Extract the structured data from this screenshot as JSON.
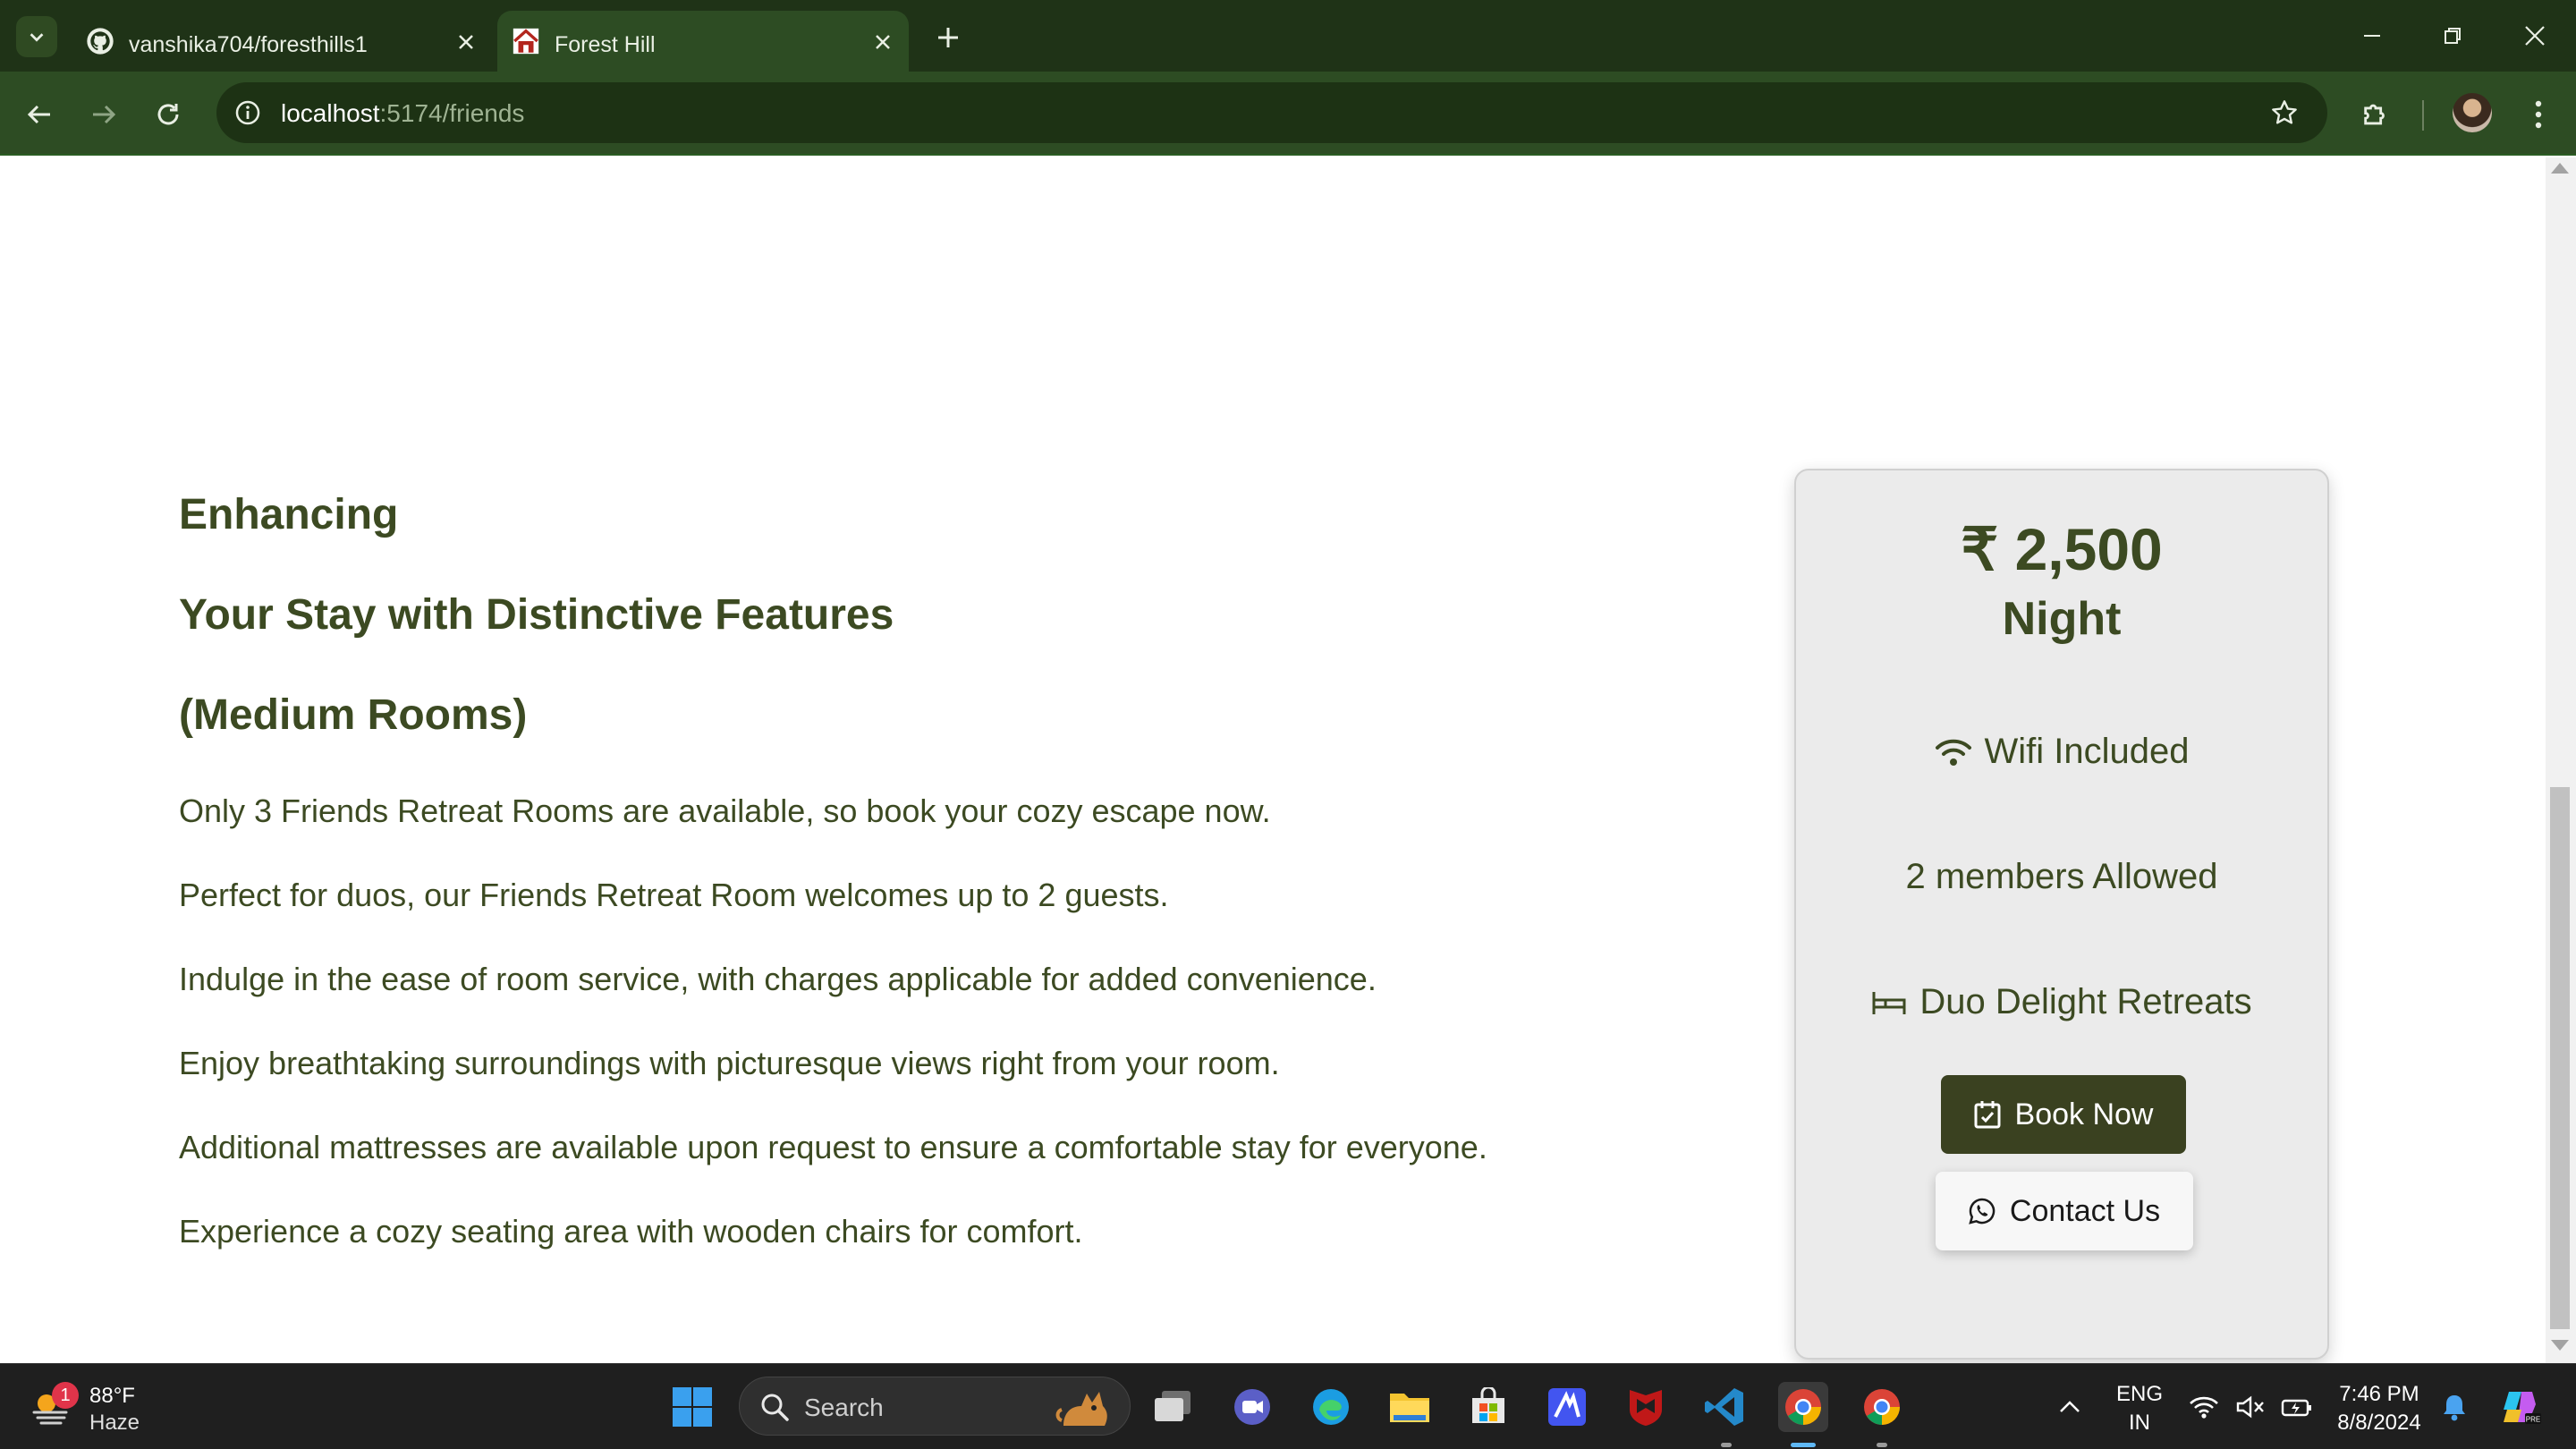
{
  "browser": {
    "tabs": [
      {
        "title": "vanshika704/foresthills1",
        "icon": "github-icon",
        "active": false
      },
      {
        "title": "Forest Hill",
        "icon": "house-icon",
        "active": true
      }
    ],
    "url_host": "localhost",
    "url_path": ":5174/friends"
  },
  "content": {
    "heading_line1": "Enhancing",
    "heading_line2": "Your Stay with Distinctive Features",
    "heading_line3": "(Medium Rooms)",
    "features": [
      "Only 3 Friends Retreat Rooms are available, so book your cozy escape now.",
      "Perfect for duos, our Friends Retreat Room welcomes up to 2 guests.",
      "Indulge in the ease of room service, with charges applicable for added convenience.",
      "Enjoy breathtaking surroundings with picturesque views right from your room.",
      "Additional mattresses are available upon request to ensure a comfortable stay for everyone.",
      "Experience a cozy seating area with wooden chairs for comfort."
    ]
  },
  "card": {
    "price": "₹ 2,500",
    "per": "Night",
    "wifi": "Wifi Included",
    "members": "2 members Allowed",
    "bed": "Duo Delight Retreats",
    "book_label": "Book Now",
    "contact_label": "Contact Us"
  },
  "taskbar": {
    "weather_temp": "88°F",
    "weather_cond": "Haze",
    "weather_badge": "1",
    "search_label": "Search",
    "lang_top": "ENG",
    "lang_bottom": "IN",
    "time": "7:46 PM",
    "date": "8/8/2024"
  },
  "colors": {
    "chrome_dark": "#1f3317",
    "chrome_mid": "#2d4c23",
    "brand_text": "#3c4a22",
    "button_dark": "#3a4120"
  }
}
